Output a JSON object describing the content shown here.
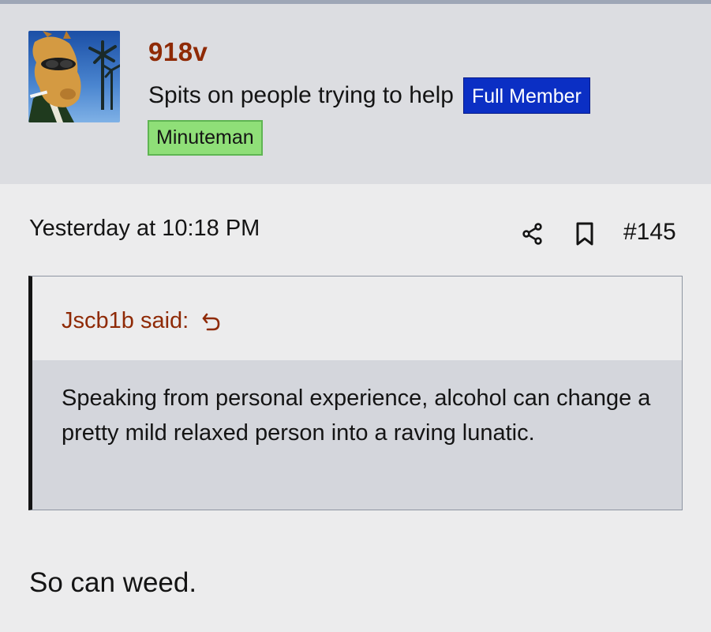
{
  "post": {
    "author": {
      "username": "918v",
      "user_title": "Spits on people trying to help",
      "badges": [
        "Full Member",
        "Minuteman"
      ],
      "avatar_icon": "camel-avatar-icon"
    },
    "date": "Yesterday at 10:18 PM",
    "number": "#145",
    "actions": {
      "share_icon": "share-icon",
      "bookmark_icon": "bookmark-icon"
    },
    "quote": {
      "author_said": "Jscb1b said:",
      "jump_icon": "return-arrow-icon",
      "text": "Speaking from personal experience, alcohol can change a pretty mild relaxed person into a raving lunatic."
    },
    "body": "So can weed."
  },
  "colors": {
    "header_bg": "#dcdde1",
    "page_bg": "#ececed",
    "username": "#8f2a06",
    "badge_full_member": "#0b2fc4",
    "badge_minuteman": "#8fdf78",
    "quote_body_bg": "#d4d6dc"
  }
}
